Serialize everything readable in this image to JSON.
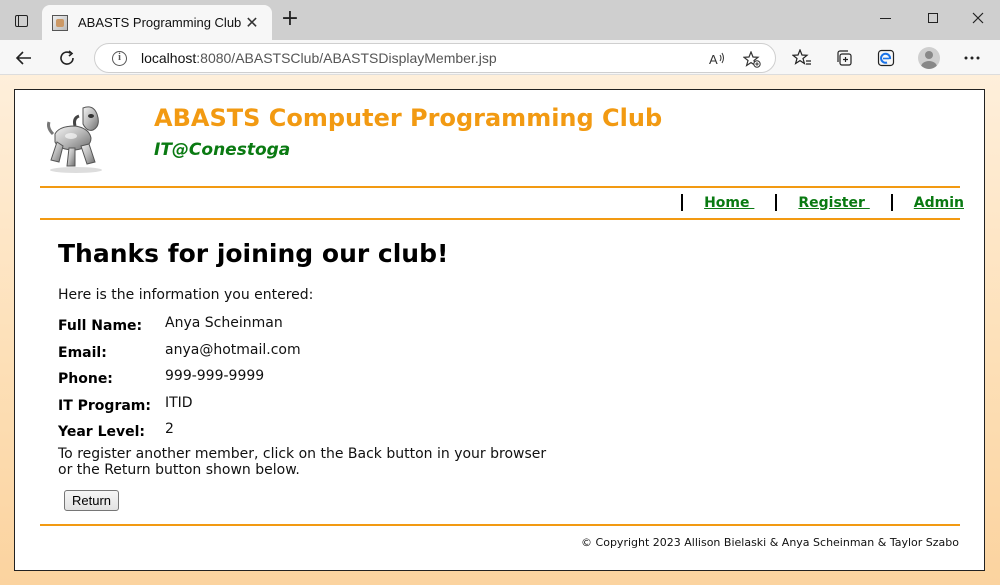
{
  "browser": {
    "tab_title": "ABASTS Programming Club",
    "tab_close": "✕",
    "new_tab": "+",
    "url_host": "localhost",
    "url_path": ":8080/ABASTSClub/ABASTSDisplayMember.jsp",
    "info_glyph": "i"
  },
  "header": {
    "title": "ABASTS Computer Programming Club",
    "subtitle": "IT@Conestoga"
  },
  "nav": {
    "items": [
      {
        "label": "Home "
      },
      {
        "label": "Register "
      },
      {
        "label": "Admin"
      }
    ]
  },
  "main": {
    "heading": "Thanks for joining our club!",
    "intro": "Here is the information you entered:",
    "fields": [
      {
        "label": "Full Name:",
        "value": "Anya Scheinman"
      },
      {
        "label": "Email:",
        "value": "anya@hotmail.com"
      },
      {
        "label": "Phone:",
        "value": "999-999-9999"
      },
      {
        "label": "IT Program:",
        "value": "ITID"
      },
      {
        "label": "Year Level:",
        "value": "2"
      }
    ],
    "note": "To register another member, click on the Back button in your browser or the Return button shown below.",
    "return_label": "Return"
  },
  "footer": {
    "copyright": "© Copyright 2023 Allison Bielaski & Anya Scheinman & Taylor Szabo"
  },
  "colors": {
    "accent_orange": "#f29a12",
    "link_green": "#0a7a12"
  }
}
